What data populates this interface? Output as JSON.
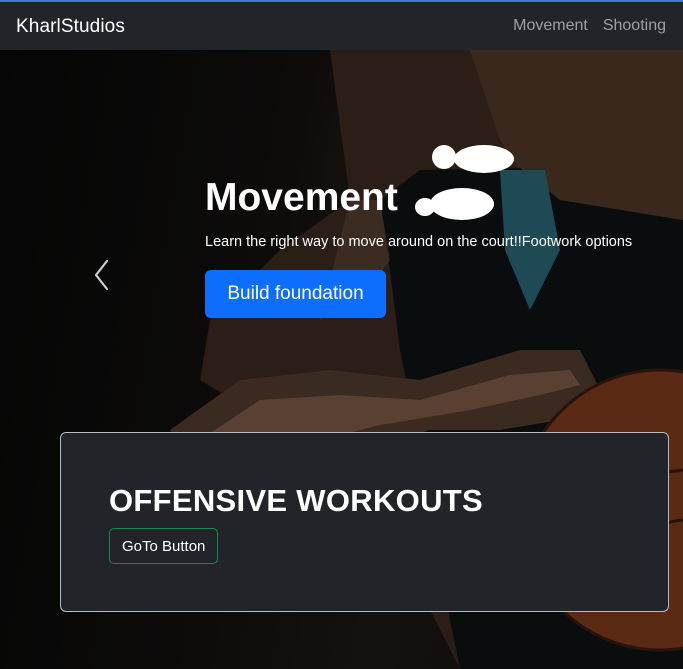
{
  "navbar": {
    "brand": "KharlStudios",
    "links": [
      "Movement",
      "Shooting"
    ]
  },
  "hero": {
    "title": "Movement",
    "subtitle": "Learn the right way to move around on the court!!Footwork options",
    "cta_label": "Build foundation",
    "prev_icon": "chevron-left-icon",
    "title_icon": "footprints-icon"
  },
  "card": {
    "title": "OFFENSIVE WORKOUTS",
    "button_label": "GoTo Button"
  },
  "colors": {
    "navbar_bg": "#212529",
    "primary": "#0d6efd",
    "card_bg": "#212529",
    "success_outline": "#198754"
  }
}
